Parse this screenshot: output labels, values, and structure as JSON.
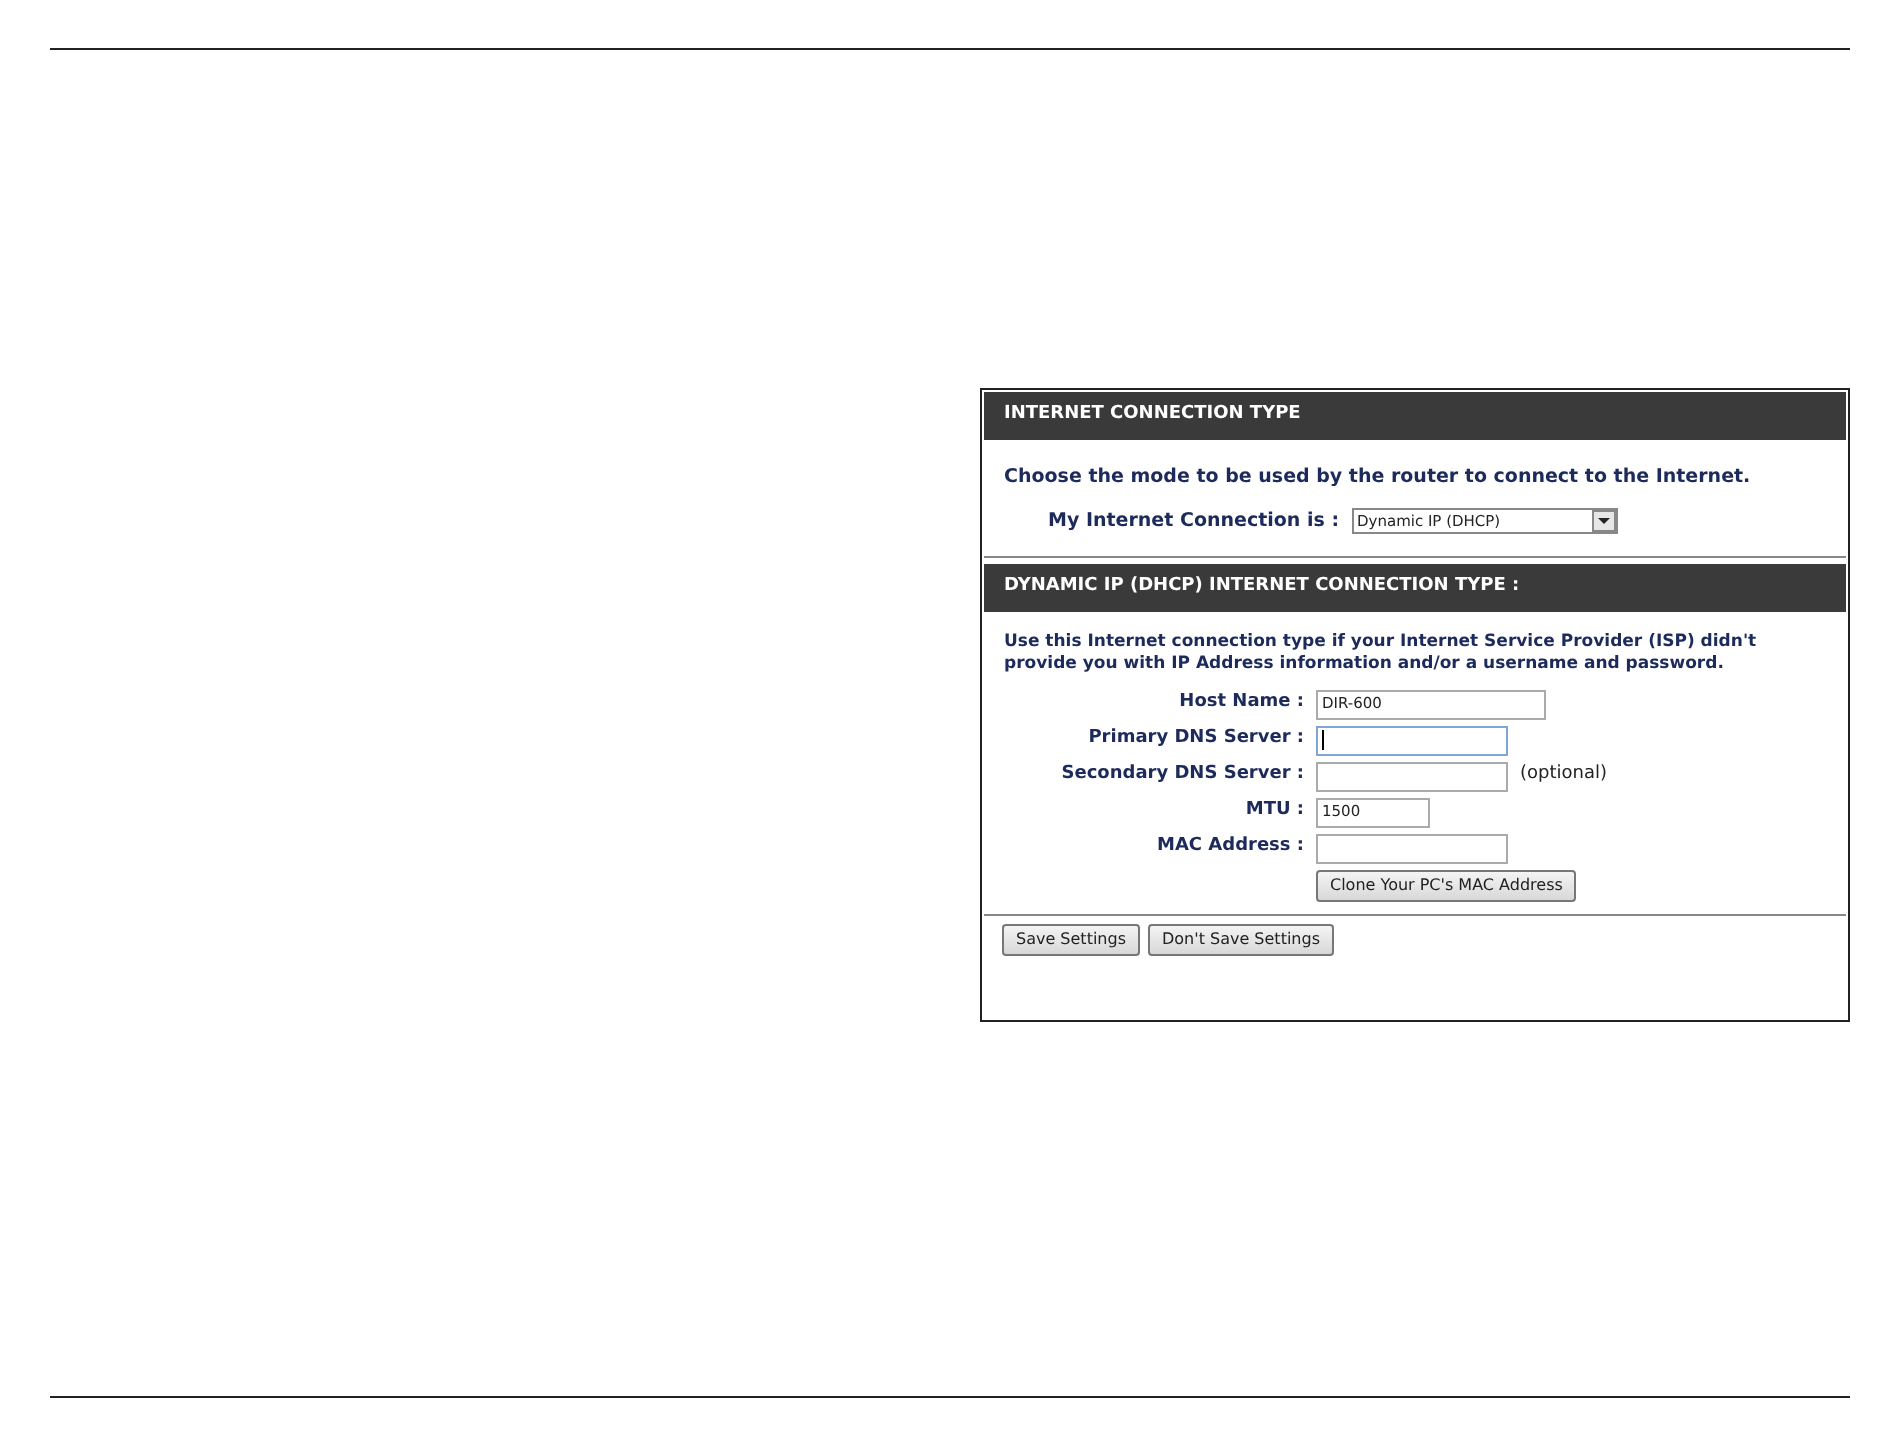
{
  "connection_type": {
    "title": "INTERNET CONNECTION TYPE",
    "instruction": "Choose the mode to be used by the router to connect to the Internet.",
    "label": "My Internet Connection is :",
    "value": "Dynamic IP (DHCP)"
  },
  "dhcp": {
    "title": "DYNAMIC IP (DHCP) INTERNET CONNECTION TYPE :",
    "description": "Use this Internet connection type if your Internet Service Provider (ISP) didn't provide you with IP Address information and/or a username and password.",
    "fields": [
      {
        "label": "Host Name :",
        "value": "DIR-600",
        "focused": false
      },
      {
        "label": "Primary DNS Server :",
        "focused": true
      },
      {
        "label": "Secondary DNS Server :",
        "focused": false,
        "note": "(optional)"
      },
      {
        "label": "MTU :",
        "value": "1500",
        "focused": false
      },
      {
        "label": "MAC Address :",
        "focused": false
      }
    ],
    "clone_button": "Clone Your PC's MAC Address"
  },
  "buttons": [
    "Save Settings",
    "Don't Save Settings"
  ]
}
